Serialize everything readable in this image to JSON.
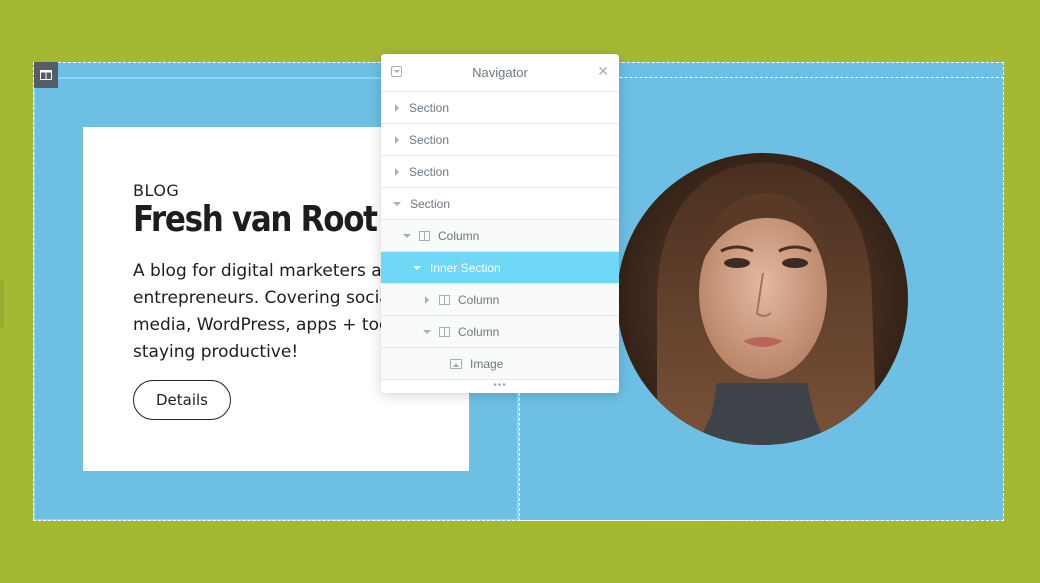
{
  "card": {
    "kicker": "BLOG",
    "title": "Fresh van Root",
    "body": "A blog for digital marketers and entrepreneurs. Covering social media, WordPress, apps + tools for staying productive!",
    "button": "Details"
  },
  "navigator": {
    "title": "Navigator",
    "close_glyph": "✕",
    "footer_glyph": "•••",
    "items": [
      {
        "label": "Section",
        "level": 0,
        "state": "collapsed",
        "icon": "caret-right-icon"
      },
      {
        "label": "Section",
        "level": 0,
        "state": "collapsed",
        "icon": "caret-right-icon"
      },
      {
        "label": "Section",
        "level": 0,
        "state": "collapsed",
        "icon": "caret-right-icon"
      },
      {
        "label": "Section",
        "level": 0,
        "state": "expanded",
        "icon": "caret-down-icon"
      },
      {
        "label": "Column",
        "level": 1,
        "state": "expanded",
        "icon": "column-icon"
      },
      {
        "label": "Inner Section",
        "level": 2,
        "state": "expanded",
        "selected": true
      },
      {
        "label": "Column",
        "level": 3,
        "state": "collapsed",
        "icon": "column-icon"
      },
      {
        "label": "Column",
        "level": 3,
        "state": "expanded",
        "icon": "column-icon"
      },
      {
        "label": "Image",
        "level": 4,
        "icon": "image-icon"
      }
    ]
  },
  "colors": {
    "page_background": "#a5b834",
    "section_background": "#6dbfe4",
    "selected_row": "#71d7f7",
    "handle": "#555d66"
  },
  "icons": [
    "column-layout-icon",
    "collapse-icon",
    "close-icon",
    "caret-right-icon",
    "caret-down-icon",
    "column-icon",
    "image-icon",
    "more-dots-icon"
  ]
}
